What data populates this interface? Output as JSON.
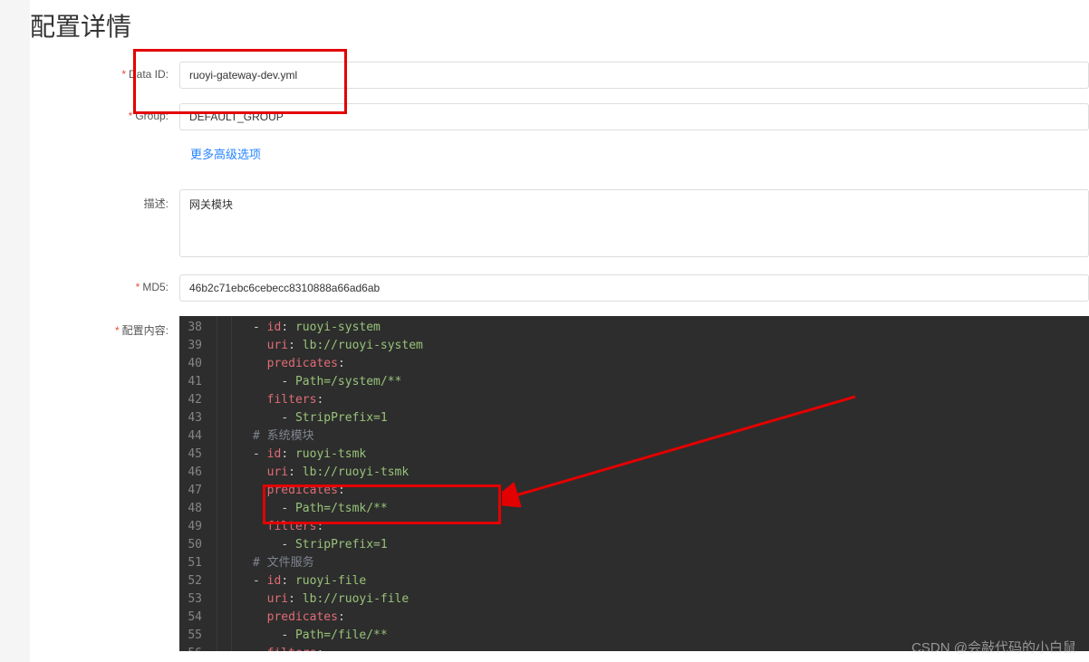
{
  "title": "配置详情",
  "form": {
    "dataIdLabel": "Data ID:",
    "dataIdValue": "ruoyi-gateway-dev.yml",
    "groupLabel": "Group:",
    "groupValue": "DEFAULT_GROUP",
    "moreOptions": "更多高级选项",
    "descLabel": "描述:",
    "descValue": "网关模块",
    "md5Label": "MD5:",
    "md5Value": "46b2c71ebc6cebecc8310888a66ad6ab",
    "contentLabel": "配置内容:"
  },
  "editor": {
    "startLine": 38,
    "lines": [
      {
        "indent": 4,
        "segs": [
          [
            "punc",
            "- "
          ],
          [
            "key",
            "id"
          ],
          [
            "punc",
            ": "
          ],
          [
            "val",
            "ruoyi-system"
          ]
        ]
      },
      {
        "indent": 5,
        "segs": [
          [
            "key",
            "uri"
          ],
          [
            "punc",
            ": "
          ],
          [
            "val",
            "lb://ruoyi-system"
          ]
        ]
      },
      {
        "indent": 5,
        "segs": [
          [
            "key",
            "predicates"
          ],
          [
            "punc",
            ":"
          ]
        ]
      },
      {
        "indent": 6,
        "segs": [
          [
            "punc",
            "- "
          ],
          [
            "val",
            "Path=/system/**"
          ]
        ]
      },
      {
        "indent": 5,
        "segs": [
          [
            "key",
            "filters"
          ],
          [
            "punc",
            ":"
          ]
        ]
      },
      {
        "indent": 6,
        "segs": [
          [
            "punc",
            "- "
          ],
          [
            "val",
            "StripPrefix=1"
          ]
        ]
      },
      {
        "indent": 4,
        "segs": [
          [
            "comment",
            "# 系统模块"
          ]
        ]
      },
      {
        "indent": 4,
        "segs": [
          [
            "punc",
            "- "
          ],
          [
            "key",
            "id"
          ],
          [
            "punc",
            ": "
          ],
          [
            "val",
            "ruoyi-tsmk"
          ]
        ]
      },
      {
        "indent": 5,
        "segs": [
          [
            "key",
            "uri"
          ],
          [
            "punc",
            ": "
          ],
          [
            "val",
            "lb://ruoyi-tsmk"
          ]
        ]
      },
      {
        "indent": 5,
        "segs": [
          [
            "key",
            "predicates"
          ],
          [
            "punc",
            ":"
          ]
        ]
      },
      {
        "indent": 6,
        "segs": [
          [
            "punc",
            "- "
          ],
          [
            "val",
            "Path=/tsmk/**"
          ]
        ]
      },
      {
        "indent": 5,
        "segs": [
          [
            "key",
            "filters"
          ],
          [
            "punc",
            ":"
          ]
        ]
      },
      {
        "indent": 6,
        "segs": [
          [
            "punc",
            "- "
          ],
          [
            "val",
            "StripPrefix=1"
          ]
        ]
      },
      {
        "indent": 4,
        "segs": [
          [
            "comment",
            "# 文件服务"
          ]
        ]
      },
      {
        "indent": 4,
        "segs": [
          [
            "punc",
            "- "
          ],
          [
            "key",
            "id"
          ],
          [
            "punc",
            ": "
          ],
          [
            "val",
            "ruoyi-file"
          ]
        ]
      },
      {
        "indent": 5,
        "segs": [
          [
            "key",
            "uri"
          ],
          [
            "punc",
            ": "
          ],
          [
            "val",
            "lb://ruoyi-file"
          ]
        ]
      },
      {
        "indent": 5,
        "segs": [
          [
            "key",
            "predicates"
          ],
          [
            "punc",
            ":"
          ]
        ]
      },
      {
        "indent": 6,
        "segs": [
          [
            "punc",
            "- "
          ],
          [
            "val",
            "Path=/file/**"
          ]
        ]
      },
      {
        "indent": 5,
        "segs": [
          [
            "key",
            "filters"
          ],
          [
            "punc",
            ":"
          ]
        ]
      }
    ]
  },
  "watermark": "CSDN @会敲代码的小白鼠"
}
